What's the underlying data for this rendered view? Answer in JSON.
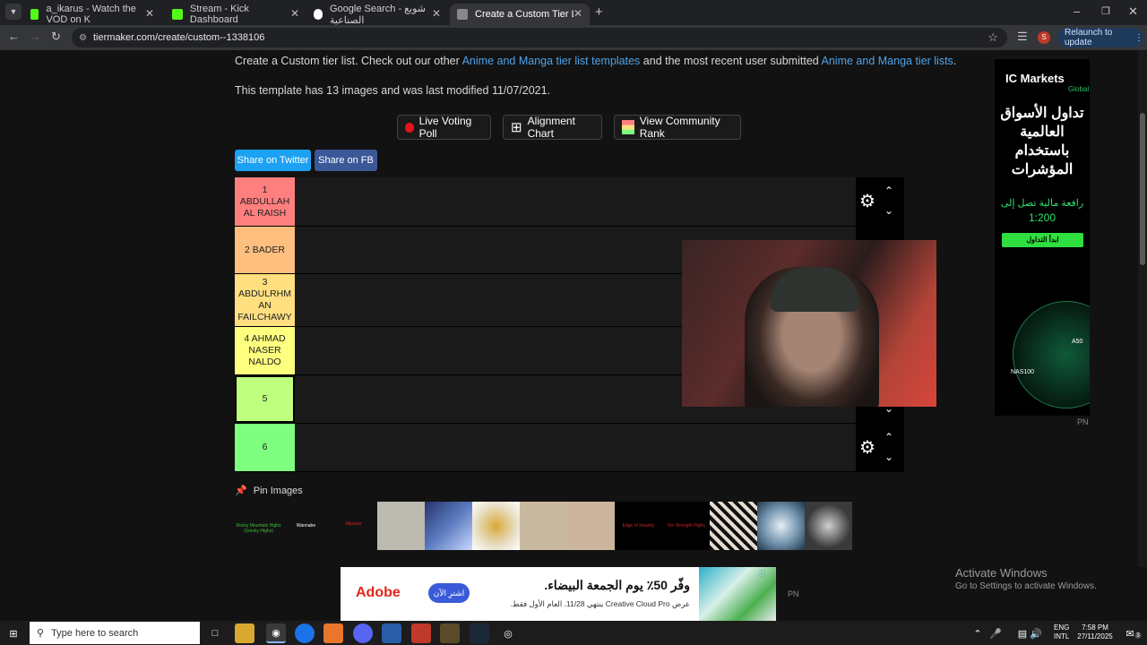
{
  "tabs": [
    {
      "title": "a_ikarus - Watch the VOD on K",
      "color": "#53fc18"
    },
    {
      "title": "Stream - Kick Dashboard",
      "color": "#53fc18"
    },
    {
      "title": "Google Search - شويع الصناعية",
      "color": "#4285f4"
    },
    {
      "title": "Create a Custom Tier List - Tier",
      "color": "#555555"
    }
  ],
  "toolbar": {
    "url": "tiermaker.com/create/custom--1338106",
    "relaunch": "Relaunch to update",
    "profile": "S"
  },
  "page": {
    "intro_pre": "Create a Custom tier list. Check out our other ",
    "intro_link1": "Anime and Manga tier list templates",
    "intro_mid": " and the most recent user submitted ",
    "intro_link2": "Anime and Manga tier lists",
    "intro_end": ".",
    "template_info": "This template has 13 images and was last modified 11/07/2021.",
    "btn_poll": "Live Voting Poll",
    "btn_align": "Alignment Chart",
    "btn_rank": "View Community Rank",
    "share_twitter": "Share on Twitter",
    "share_fb": "Share on FB",
    "pin_images": "Pin Images"
  },
  "tiers": [
    {
      "label": "1\nABDULLAH\nAL RAISH",
      "color": "#ff7f7f"
    },
    {
      "label": "2  BADER",
      "color": "#ffbf7f"
    },
    {
      "label": "3\nABDULRHM\nAN\nFAILCHAWY",
      "color": "#ffdf7f"
    },
    {
      "label": "4 AHMAD\nNASER\nNALDO",
      "color": "#ffff7f"
    },
    {
      "label": "5",
      "color": "#bfff7f"
    },
    {
      "label": "6",
      "color": "#7fff7f"
    }
  ],
  "pool": [
    {
      "text": "Rocky Mountain Highs (Smoky Highs)",
      "bg": "#000000",
      "color": "#3fbf3f"
    },
    {
      "text": "Wannabe",
      "bg": "#000000",
      "color": "#ffffff"
    },
    {
      "text": "Alkatraz",
      "bg": "#000000",
      "color": "#cc2222"
    },
    {
      "text": "",
      "bg": "#bdbab0",
      "color": "#000"
    },
    {
      "text": "",
      "bg": "#5a7bbf",
      "color": "#000"
    },
    {
      "text": "",
      "bg": "#e8e0c8",
      "color": "#000"
    },
    {
      "text": "",
      "bg": "#c9b9a0",
      "color": "#000"
    },
    {
      "text": "",
      "bg": "#cbb59c",
      "color": "#000"
    },
    {
      "text": "Edge of Insanity",
      "bg": "#000000",
      "color": "#cc2222"
    },
    {
      "text": "Ten Strength Highs",
      "bg": "#000000",
      "color": "#cc2222"
    },
    {
      "text": "",
      "bg": "#d7c7b5",
      "color": "#000"
    },
    {
      "text": "",
      "bg": "#6f90aa",
      "color": "#000"
    },
    {
      "text": "",
      "bg": "#3a3a3a",
      "color": "#000"
    }
  ],
  "ad_side": {
    "brand": "IC Markets",
    "brand_sub": "Global",
    "headline": "تداول الأسواق العالمية باستخدام المؤشرات",
    "leverage": "رافعة مالية تصل إلى",
    "leverage_val": "1:200",
    "cta": "ابدأ التداول",
    "label1": "A50",
    "label2": "NAS100"
  },
  "ad_bottom": {
    "brand": "Adobe",
    "cta": "اشترِ الآن",
    "headline": "وفّر 50٪ يوم الجمعة البيضاء.",
    "sub": "عرض Creative Cloud Pro ينتهي 11/28. العام الأول فقط."
  },
  "pn": "PN",
  "activate": {
    "title": "Activate Windows",
    "sub": "Go to Settings to activate Windows."
  },
  "taskbar": {
    "search": "Type here to search",
    "lang1": "ENG",
    "lang2": "INTL",
    "time": "7:58 PM",
    "date": "27/11/2025",
    "notif": "3"
  }
}
